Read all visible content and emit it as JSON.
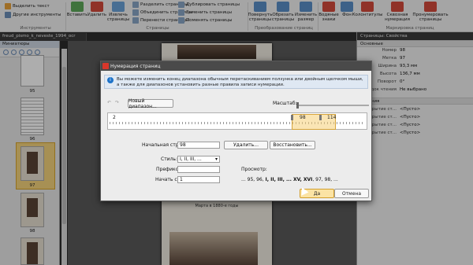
{
  "ribbon": {
    "items": [
      "Выделить текст",
      "Другие инструменты",
      "Вставить",
      "Удалить",
      "Извлечь страницы",
      "Разделить страницы",
      "Объединить страницы",
      "Перенести страницы",
      "Дублировать страницы",
      "Заменить страницы",
      "Поменять страницы",
      "Повернуть страницы",
      "Обрезать страницы",
      "Изменить размер",
      "Водяные знаки",
      "Фон",
      "Колонтитулы",
      "Сквозная нумерация",
      "Пронумеровать страницы"
    ],
    "groups": [
      "Инструменты",
      "Страницы",
      "Преобразование страниц",
      "Маркировка страниц"
    ]
  },
  "document": {
    "tab": "freud_pismo_k_neveste_1994_ocr"
  },
  "thumbnails": {
    "header": "Миниатюры",
    "pages": [
      "95",
      "96",
      "97",
      "98"
    ],
    "selected": "97"
  },
  "viewer": {
    "caption": "Марта в 1880-е годы"
  },
  "properties": {
    "header": "Страницы: Свойства",
    "group_main": "Основные",
    "group_section": "Сечения",
    "rows": [
      {
        "k": "Номер",
        "v": "98"
      },
      {
        "k": "Метка",
        "v": "97"
      },
      {
        "k": "Ширина",
        "v": "93,3 мм"
      },
      {
        "k": "Высота",
        "v": "136,7 мм"
      },
      {
        "k": "Поворот",
        "v": "0°"
      },
      {
        "k": "Порядок чтения",
        "v": "Не выбрано"
      }
    ],
    "rows2": [
      {
        "k": "Открытие ст...",
        "v": "<Пусто>"
      },
      {
        "k": "Закрытие ст...",
        "v": "<Пусто>"
      },
      {
        "k": "Открытие ст...",
        "v": "<Пусто>"
      },
      {
        "k": "Закрытие ст...",
        "v": "<Пусто>"
      }
    ]
  },
  "dialog": {
    "title": "Нумерация страниц",
    "info": "Вы можете изменить конец диапазона обычным перетаскиванием ползунка или двойным щелчком мыши, а также для диапазонов установить разные правила записи нумерации.",
    "new_range": "Новый диапазон...",
    "zoom_label": "Масштаб:",
    "range": {
      "start": "2",
      "current": "98",
      "end": "114"
    },
    "start_label": "Начальная стр.:",
    "start_value": "98",
    "delete": "Удалить...",
    "restore": "Восстановить...",
    "style_label": "Стиль:",
    "style_value": "I, II, III, ...",
    "prefix_label": "Префикс:",
    "prefix_value": "",
    "startfrom_label": "Начать с:",
    "startfrom_value": "1",
    "preview_label": "Просмотр:",
    "preview_plain": "... 95, 96, ",
    "preview_bold": "I, II, III, ... XV, XVI",
    "preview_tail": ", 97, 98, ...",
    "ok": "Да",
    "cancel": "Отмена"
  }
}
